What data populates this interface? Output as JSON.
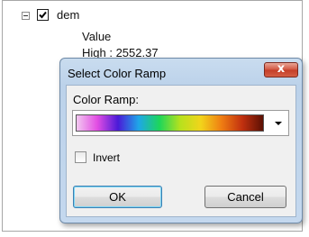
{
  "toc": {
    "layer_name": "dem",
    "layer_checked": true,
    "value_heading": "Value",
    "high_label": "High : 2552.37"
  },
  "dialog": {
    "title": "Select Color Ramp",
    "close_label": "x",
    "ramp_label": "Color Ramp:",
    "ramp_colors": [
      "#f2c8f0",
      "#e24de3",
      "#4a1bd8",
      "#1ea7e8",
      "#1dd65a",
      "#b7e11d",
      "#f2d41b",
      "#ef7d12",
      "#c1300f",
      "#5b1004"
    ],
    "invert_label": "Invert",
    "invert_checked": false,
    "ok_label": "OK",
    "cancel_label": "Cancel"
  }
}
